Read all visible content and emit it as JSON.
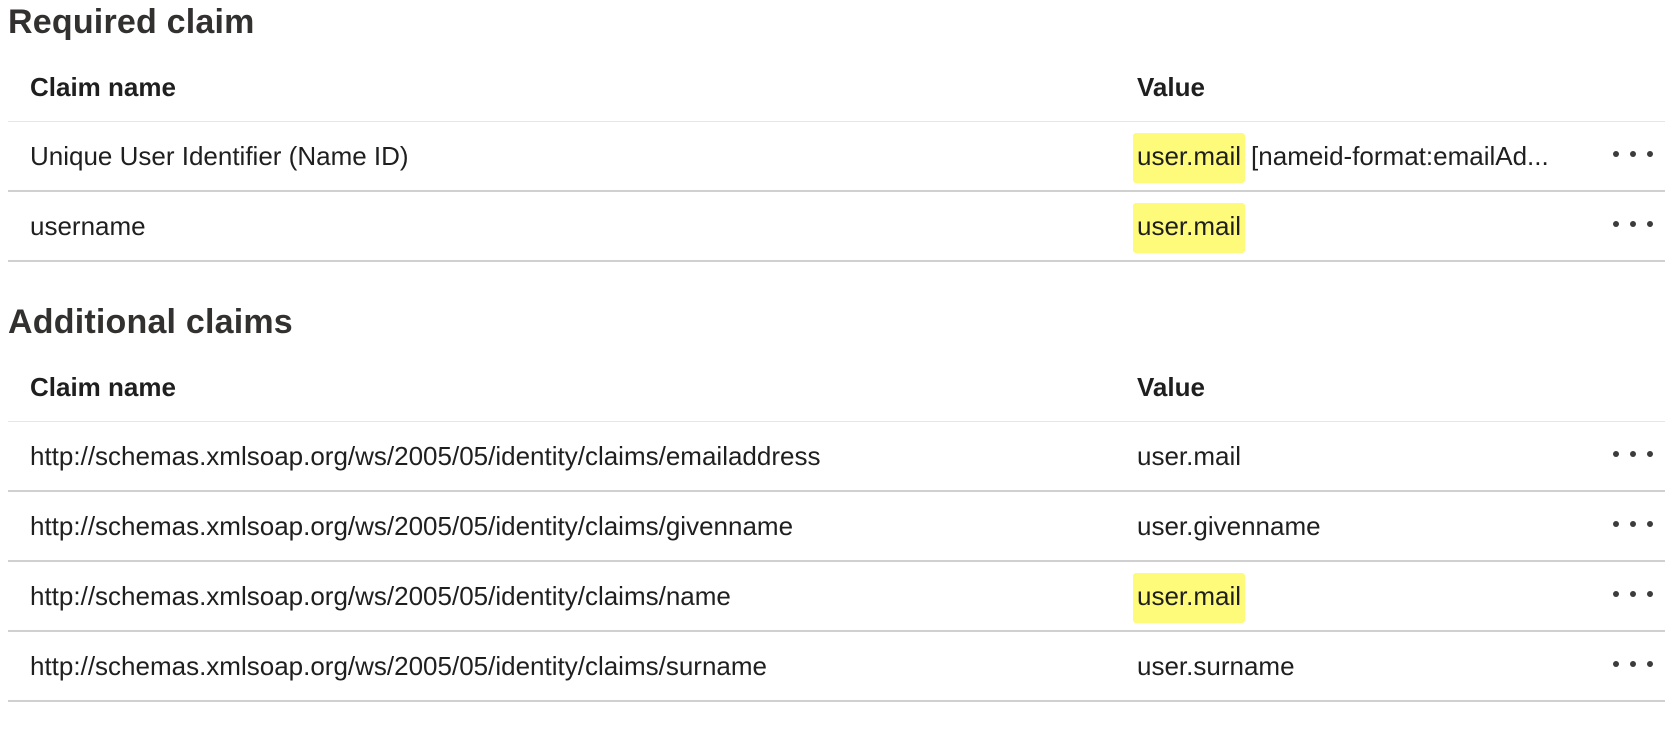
{
  "required": {
    "title": "Required claim",
    "headers": {
      "name": "Claim name",
      "value": "Value"
    },
    "rows": [
      {
        "name": "Unique User Identifier (Name ID)",
        "value": "user.mail",
        "suffix": "[nameid-format:emailAd...",
        "highlighted": true
      },
      {
        "name": "username",
        "value": "user.mail",
        "suffix": "",
        "highlighted": true
      }
    ]
  },
  "additional": {
    "title": "Additional claims",
    "headers": {
      "name": "Claim name",
      "value": "Value"
    },
    "rows": [
      {
        "name": "http://schemas.xmlsoap.org/ws/2005/05/identity/claims/emailaddress",
        "value": "user.mail",
        "highlighted": false
      },
      {
        "name": "http://schemas.xmlsoap.org/ws/2005/05/identity/claims/givenname",
        "value": "user.givenname",
        "highlighted": false
      },
      {
        "name": "http://schemas.xmlsoap.org/ws/2005/05/identity/claims/name",
        "value": "user.mail",
        "highlighted": true
      },
      {
        "name": "http://schemas.xmlsoap.org/ws/2005/05/identity/claims/surname",
        "value": "user.surname",
        "highlighted": false
      }
    ]
  },
  "colors": {
    "highlight": "#fdfb79",
    "divider": "#d0d0d0",
    "text": "#1f1f1f"
  },
  "icons": {
    "row_menu": "more-horizontal-icon"
  }
}
